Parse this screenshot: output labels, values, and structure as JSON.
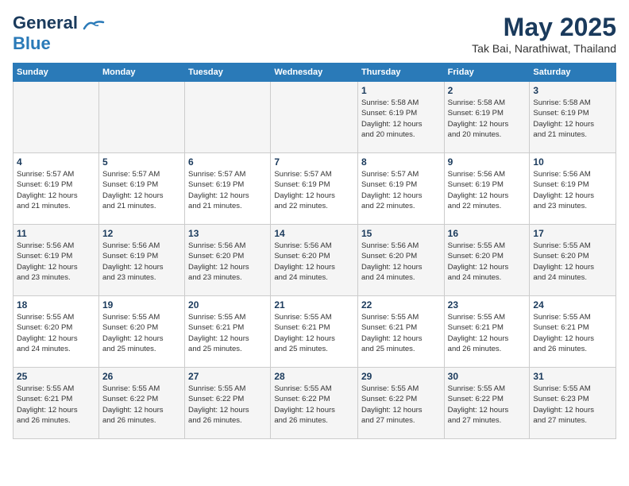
{
  "header": {
    "logo_line1": "General",
    "logo_line2": "Blue",
    "month_year": "May 2025",
    "location": "Tak Bai, Narathiwat, Thailand"
  },
  "days_of_week": [
    "Sunday",
    "Monday",
    "Tuesday",
    "Wednesday",
    "Thursday",
    "Friday",
    "Saturday"
  ],
  "weeks": [
    [
      {
        "num": "",
        "info": ""
      },
      {
        "num": "",
        "info": ""
      },
      {
        "num": "",
        "info": ""
      },
      {
        "num": "",
        "info": ""
      },
      {
        "num": "1",
        "info": "Sunrise: 5:58 AM\nSunset: 6:19 PM\nDaylight: 12 hours\nand 20 minutes."
      },
      {
        "num": "2",
        "info": "Sunrise: 5:58 AM\nSunset: 6:19 PM\nDaylight: 12 hours\nand 20 minutes."
      },
      {
        "num": "3",
        "info": "Sunrise: 5:58 AM\nSunset: 6:19 PM\nDaylight: 12 hours\nand 21 minutes."
      }
    ],
    [
      {
        "num": "4",
        "info": "Sunrise: 5:57 AM\nSunset: 6:19 PM\nDaylight: 12 hours\nand 21 minutes."
      },
      {
        "num": "5",
        "info": "Sunrise: 5:57 AM\nSunset: 6:19 PM\nDaylight: 12 hours\nand 21 minutes."
      },
      {
        "num": "6",
        "info": "Sunrise: 5:57 AM\nSunset: 6:19 PM\nDaylight: 12 hours\nand 21 minutes."
      },
      {
        "num": "7",
        "info": "Sunrise: 5:57 AM\nSunset: 6:19 PM\nDaylight: 12 hours\nand 22 minutes."
      },
      {
        "num": "8",
        "info": "Sunrise: 5:57 AM\nSunset: 6:19 PM\nDaylight: 12 hours\nand 22 minutes."
      },
      {
        "num": "9",
        "info": "Sunrise: 5:56 AM\nSunset: 6:19 PM\nDaylight: 12 hours\nand 22 minutes."
      },
      {
        "num": "10",
        "info": "Sunrise: 5:56 AM\nSunset: 6:19 PM\nDaylight: 12 hours\nand 23 minutes."
      }
    ],
    [
      {
        "num": "11",
        "info": "Sunrise: 5:56 AM\nSunset: 6:19 PM\nDaylight: 12 hours\nand 23 minutes."
      },
      {
        "num": "12",
        "info": "Sunrise: 5:56 AM\nSunset: 6:19 PM\nDaylight: 12 hours\nand 23 minutes."
      },
      {
        "num": "13",
        "info": "Sunrise: 5:56 AM\nSunset: 6:20 PM\nDaylight: 12 hours\nand 23 minutes."
      },
      {
        "num": "14",
        "info": "Sunrise: 5:56 AM\nSunset: 6:20 PM\nDaylight: 12 hours\nand 24 minutes."
      },
      {
        "num": "15",
        "info": "Sunrise: 5:56 AM\nSunset: 6:20 PM\nDaylight: 12 hours\nand 24 minutes."
      },
      {
        "num": "16",
        "info": "Sunrise: 5:55 AM\nSunset: 6:20 PM\nDaylight: 12 hours\nand 24 minutes."
      },
      {
        "num": "17",
        "info": "Sunrise: 5:55 AM\nSunset: 6:20 PM\nDaylight: 12 hours\nand 24 minutes."
      }
    ],
    [
      {
        "num": "18",
        "info": "Sunrise: 5:55 AM\nSunset: 6:20 PM\nDaylight: 12 hours\nand 24 minutes."
      },
      {
        "num": "19",
        "info": "Sunrise: 5:55 AM\nSunset: 6:20 PM\nDaylight: 12 hours\nand 25 minutes."
      },
      {
        "num": "20",
        "info": "Sunrise: 5:55 AM\nSunset: 6:21 PM\nDaylight: 12 hours\nand 25 minutes."
      },
      {
        "num": "21",
        "info": "Sunrise: 5:55 AM\nSunset: 6:21 PM\nDaylight: 12 hours\nand 25 minutes."
      },
      {
        "num": "22",
        "info": "Sunrise: 5:55 AM\nSunset: 6:21 PM\nDaylight: 12 hours\nand 25 minutes."
      },
      {
        "num": "23",
        "info": "Sunrise: 5:55 AM\nSunset: 6:21 PM\nDaylight: 12 hours\nand 26 minutes."
      },
      {
        "num": "24",
        "info": "Sunrise: 5:55 AM\nSunset: 6:21 PM\nDaylight: 12 hours\nand 26 minutes."
      }
    ],
    [
      {
        "num": "25",
        "info": "Sunrise: 5:55 AM\nSunset: 6:21 PM\nDaylight: 12 hours\nand 26 minutes."
      },
      {
        "num": "26",
        "info": "Sunrise: 5:55 AM\nSunset: 6:22 PM\nDaylight: 12 hours\nand 26 minutes."
      },
      {
        "num": "27",
        "info": "Sunrise: 5:55 AM\nSunset: 6:22 PM\nDaylight: 12 hours\nand 26 minutes."
      },
      {
        "num": "28",
        "info": "Sunrise: 5:55 AM\nSunset: 6:22 PM\nDaylight: 12 hours\nand 26 minutes."
      },
      {
        "num": "29",
        "info": "Sunrise: 5:55 AM\nSunset: 6:22 PM\nDaylight: 12 hours\nand 27 minutes."
      },
      {
        "num": "30",
        "info": "Sunrise: 5:55 AM\nSunset: 6:22 PM\nDaylight: 12 hours\nand 27 minutes."
      },
      {
        "num": "31",
        "info": "Sunrise: 5:55 AM\nSunset: 6:23 PM\nDaylight: 12 hours\nand 27 minutes."
      }
    ]
  ]
}
